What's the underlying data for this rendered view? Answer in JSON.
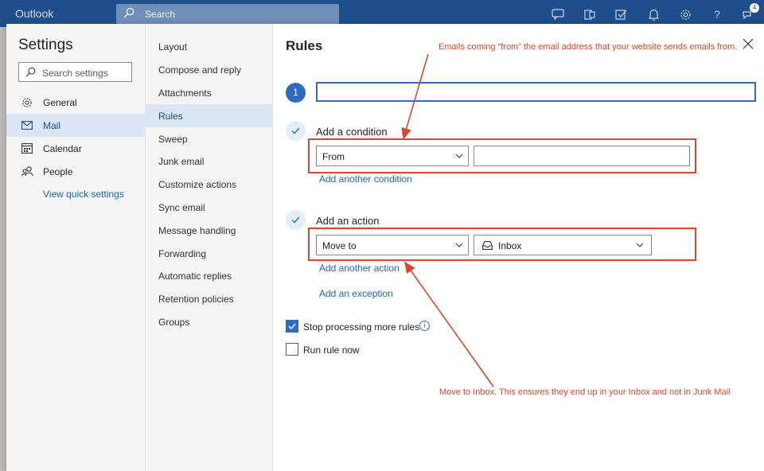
{
  "app": {
    "brand": "Outlook"
  },
  "topbar": {
    "search_placeholder": "Search",
    "icons": [
      "chat-icon",
      "office-icon",
      "todo-icon",
      "bell-icon",
      "gear-icon",
      "help-icon",
      "feedback-icon"
    ],
    "badge_count": "4"
  },
  "settings": {
    "title": "Settings",
    "search_placeholder": "Search settings",
    "nav": [
      {
        "label": "General",
        "icon": "gear-icon"
      },
      {
        "label": "Mail",
        "icon": "mail-icon",
        "active": true
      },
      {
        "label": "Calendar",
        "icon": "calendar-icon"
      },
      {
        "label": "People",
        "icon": "people-icon"
      }
    ],
    "quick_link": "View quick settings"
  },
  "mail_nav": {
    "items": [
      "Layout",
      "Compose and reply",
      "Attachments",
      "Rules",
      "Sweep",
      "Junk email",
      "Customize actions",
      "Sync email",
      "Message handling",
      "Forwarding",
      "Automatic replies",
      "Retention policies",
      "Groups"
    ],
    "active": "Rules"
  },
  "rules": {
    "title": "Rules",
    "step_number": "1",
    "rule_name_value": "",
    "condition": {
      "label": "Add a condition",
      "dropdown_value": "From",
      "text_value": "",
      "add_link": "Add another condition"
    },
    "action": {
      "label": "Add an action",
      "dropdown_value": "Move to",
      "folder_value": "Inbox",
      "add_link": "Add another action"
    },
    "exception_link": "Add an exception",
    "stop_processing": {
      "label": "Stop processing more rules",
      "checked": true
    },
    "run_now": {
      "label": "Run rule now",
      "checked": false
    }
  },
  "annotations": {
    "top": "Emails coming “from” the email address that your website sends emails from.",
    "bottom": "Move to Inbox. This ensures they end up in your Inbox and not in Junk Mail"
  },
  "colors": {
    "topbar": "#1f4e8c",
    "accent": "#2f6cc1",
    "annotation": "#d8472e",
    "active_nav": "#dae6f3"
  }
}
